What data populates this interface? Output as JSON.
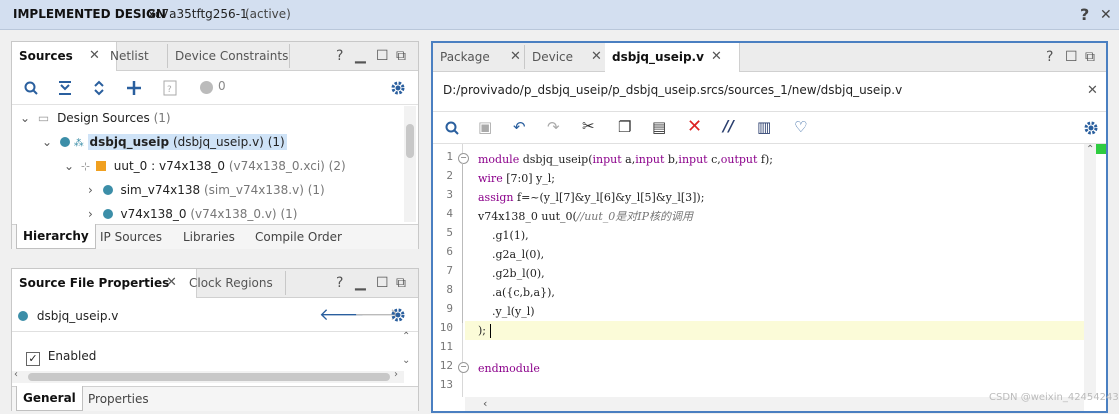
{
  "header": {
    "title": "IMPLEMENTED DESIGN",
    "part": "xc7a35tftg256-1",
    "status": "(active)",
    "help_icon": "?",
    "close_icon": "✕"
  },
  "sources_panel": {
    "tabs": [
      {
        "label": "Sources"
      },
      {
        "label": "Netlist"
      },
      {
        "label": "Device Constraints"
      }
    ],
    "close_glyph": "✕",
    "ctl": {
      "help": "?",
      "min": "▁",
      "max": "☐",
      "float": "⧉"
    },
    "count_badge": "0",
    "tree": {
      "root": {
        "label": "Design Sources",
        "count": "(1)"
      },
      "top": {
        "name": "dsbjq_useip",
        "file": "(dsbjq_useip.v)",
        "count": "(1)"
      },
      "inst": {
        "name": "uut_0 : v74x138_0",
        "file": "(v74x138_0.xci)",
        "count": "(2)"
      },
      "sim": {
        "name": "sim_v74x138",
        "file": "(sim_v74x138.v)",
        "count": "(1)"
      },
      "v74": {
        "name": "v74x138_0",
        "file": "(v74x138_0.v)",
        "count": "(1)"
      }
    },
    "bottom_tabs": [
      {
        "label": "Hierarchy"
      },
      {
        "label": "IP Sources"
      },
      {
        "label": "Libraries"
      },
      {
        "label": "Compile Order"
      }
    ]
  },
  "props_panel": {
    "tabs": [
      {
        "label": "Source File Properties"
      },
      {
        "label": "Clock Regions"
      }
    ],
    "file": "dsbjq_useip.v",
    "enabled_label": "Enabled",
    "bottom_tabs": [
      {
        "label": "General"
      },
      {
        "label": "Properties"
      }
    ]
  },
  "editor": {
    "tabs": [
      {
        "label": "Package"
      },
      {
        "label": "Device"
      },
      {
        "label": "dsbjq_useip.v"
      }
    ],
    "path": "D:/provivado/p_dsbjq_useip/p_dsbjq_useip.srcs/sources_1/new/dsbjq_useip.v",
    "line_numbers": [
      "1",
      "2",
      "3",
      "4",
      "5",
      "6",
      "7",
      "8",
      "9",
      "10",
      "11",
      "12",
      "13"
    ],
    "code": {
      "l1_kw": "module",
      "l1_rest": " dsbjq_useip(",
      "l1_in1": "input",
      "l1_a": " a,",
      "l1_in2": "input",
      "l1_b": " b,",
      "l1_in3": "input",
      "l1_c": " c,",
      "l1_out": "output",
      "l1_f": " f);",
      "l2_kw": "wire",
      "l2_rest": " [7:0] y_l;",
      "l3_kw": "assign",
      "l3_rest": " f=~(y_l[7]&y_l[6]&y_l[5]&y_l[3]);",
      "l4_code": "v74x138_0 uut_0(",
      "l4_cm": "//uut_0是对IP核的调用",
      "l5": "    .g1(1),",
      "l6": "    .g2a_l(0),",
      "l7": "    .g2b_l(0),",
      "l8": "    .a({c,b,a}),",
      "l9": "    .y_l(y_l)",
      "l10": ");",
      "l12_kw": "endmodule"
    }
  },
  "watermark": "CSDN @weixin_42454243"
}
